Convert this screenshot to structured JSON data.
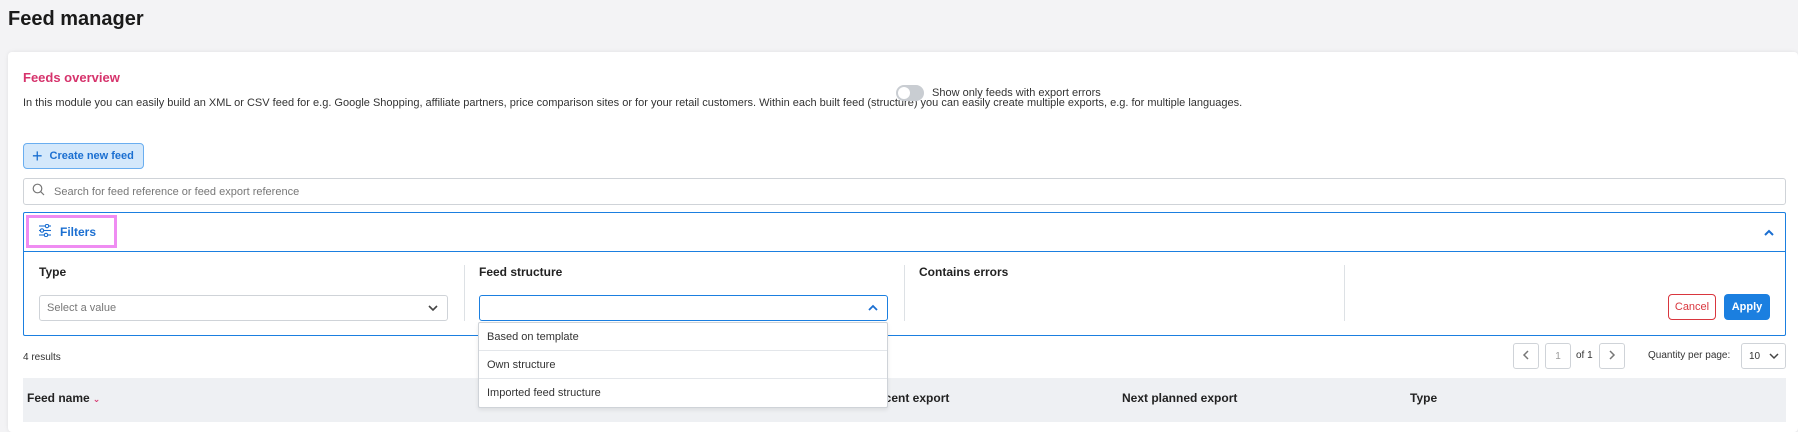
{
  "page": {
    "title": "Feed manager"
  },
  "overview": {
    "title": "Feeds overview",
    "description": "In this module you can easily build an XML or CSV feed for e.g. Google Shopping, affiliate partners, price comparison sites or for your retail customers. Within each built feed (structure) you can easily create multiple exports, e.g. for multiple languages."
  },
  "create_button": {
    "label": "Create new feed",
    "icon": "plus-icon"
  },
  "search": {
    "placeholder": "Search for feed reference or feed export reference",
    "value": ""
  },
  "filters": {
    "toggle_label": "Filters",
    "type": {
      "label": "Type",
      "placeholder": "Select a value"
    },
    "structure": {
      "label": "Feed structure",
      "value": "",
      "options": [
        "Based on template",
        "Own structure",
        "Imported feed structure"
      ]
    },
    "errors": {
      "label": "Contains errors",
      "toggle_label": "Show only feeds with export errors",
      "enabled": false
    },
    "cancel_label": "Cancel",
    "apply_label": "Apply"
  },
  "results": {
    "count_text": "4 results"
  },
  "pagination": {
    "current_page": "1",
    "total_text": "of 1",
    "qty_label": "Quantity per page:",
    "qty_value": "10"
  },
  "table": {
    "columns": [
      "Feed name",
      "ecent export",
      "Next planned export",
      "Type"
    ]
  },
  "colors": {
    "accent": "#1b7fe0",
    "brand_pink": "#d6336c",
    "danger": "#d9363e",
    "highlight": "#ef8cf2"
  }
}
